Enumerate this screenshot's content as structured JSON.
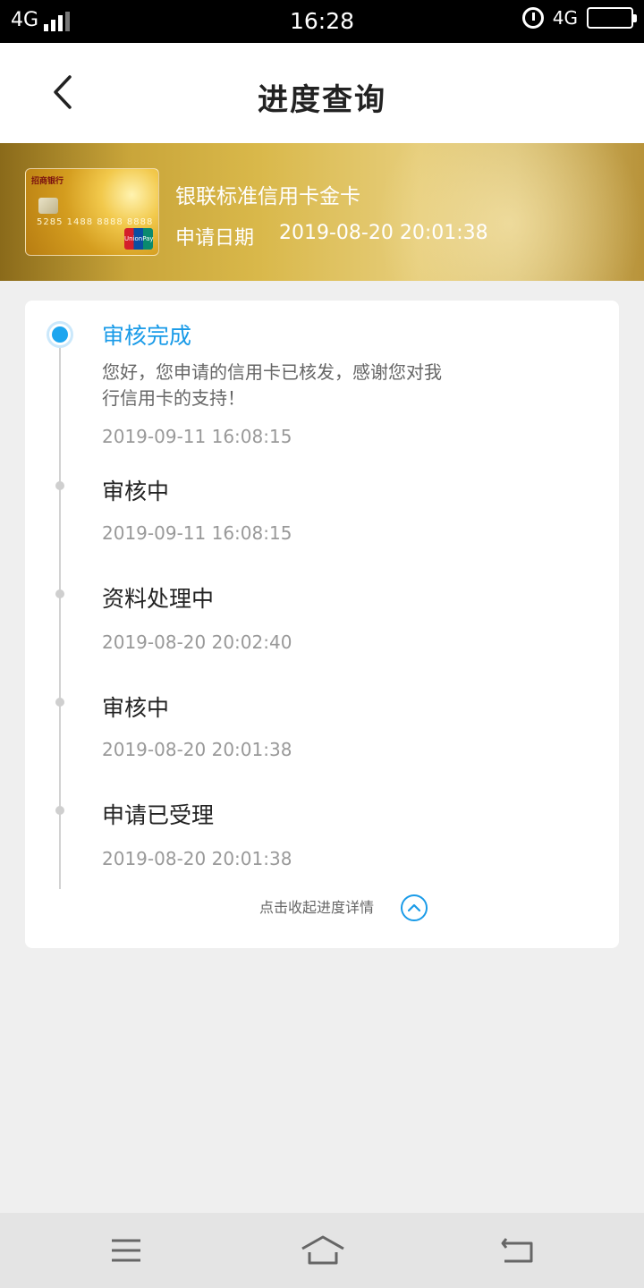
{
  "status_bar": {
    "network": "4G",
    "time": "16:28",
    "right_network": "4G"
  },
  "header": {
    "title": "进度查询"
  },
  "card": {
    "name": "银联标准信用卡金卡",
    "apply_label": "申请日期",
    "apply_date": "2019-08-20 20:01:38",
    "thumb_bank": "招商银行",
    "thumb_number": "5285 1488 8888 8888",
    "thumb_network": "UnionPay 银联"
  },
  "steps": [
    {
      "title": "审核完成",
      "desc": "您好，您申请的信用卡已核发，感谢您对我行信用卡的支持！",
      "time": "2019-09-11 16:08:15",
      "active": true
    },
    {
      "title": "审核中",
      "time": "2019-09-11 16:08:15"
    },
    {
      "title": "资料处理中",
      "time": "2019-08-20 20:02:40"
    },
    {
      "title": "审核中",
      "time": "2019-08-20 20:01:38"
    },
    {
      "title": "申请已受理",
      "time": "2019-08-20 20:01:38"
    }
  ],
  "collapse": {
    "label": "点击收起进度详情"
  },
  "colors": {
    "accent": "#1a9be8",
    "background": "#efefef"
  },
  "icons": [
    "back-arrow-icon",
    "alarm-icon",
    "battery-icon",
    "chevron-up-icon",
    "menu-icon",
    "home-icon",
    "return-icon"
  ]
}
